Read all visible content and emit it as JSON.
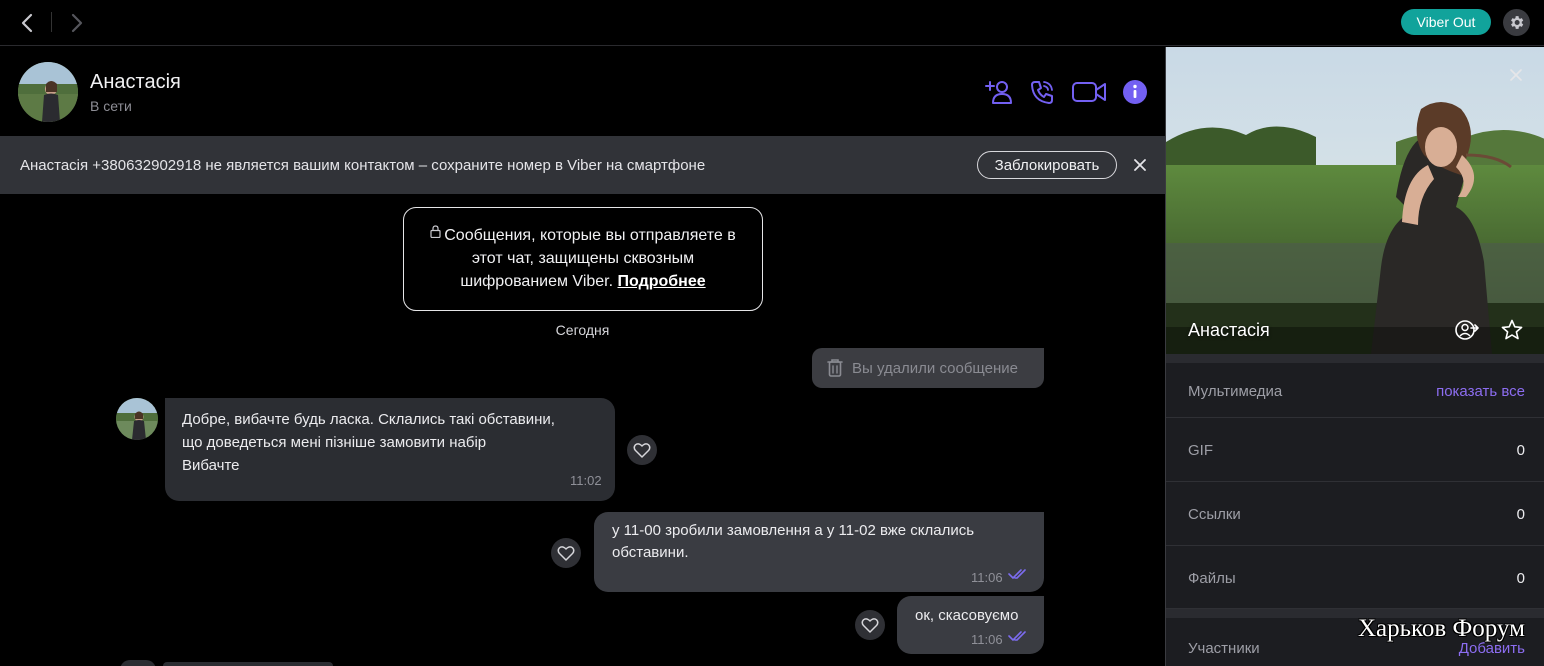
{
  "app": {
    "viber_out_label": "Viber Out"
  },
  "contact": {
    "name": "Анастасія",
    "status": "В сети"
  },
  "banner": {
    "text": "Анастасія +380632902918 не является вашим контактом – сохраните номер в Viber на смартфоне",
    "block_label": "Заблокировать"
  },
  "encryption_notice": {
    "text": "Сообщения, которые вы отправляете в этот чат, защищены сквозным шифрованием Viber.",
    "link_label": "Подробнее"
  },
  "date_separator": "Сегодня",
  "messages": [
    {
      "direction": "out",
      "deleted": true,
      "text": "Вы удалили сообщение"
    },
    {
      "direction": "in",
      "lines": [
        "Добре, вибачте будь ласка. Склались такі обставини,",
        "що доведеться мені пізніше замовити набір",
        "Вибачте"
      ],
      "time": "11:02"
    },
    {
      "direction": "out",
      "lines": [
        "у  11-00 зробили замовлення а у 11-02 вже склались",
        "обставини."
      ],
      "time": "11:06",
      "read": true
    },
    {
      "direction": "out",
      "lines": [
        "ок, скасовуємо"
      ],
      "time": "11:06",
      "read": true
    }
  ],
  "profile": {
    "name": "Анастасія",
    "media_label": "Мультимедиа",
    "media_link": "показать все",
    "rows": [
      {
        "label": "GIF",
        "value": "0"
      },
      {
        "label": "Ссылки",
        "value": "0"
      },
      {
        "label": "Файлы",
        "value": "0"
      }
    ],
    "participants_label": "Участники",
    "participants_action": "Добавить"
  },
  "watermark": "Харьков Форум",
  "colors": {
    "accent": "#7360f2",
    "viber_out": "#11a39b",
    "incoming_bubble": "#2b2d32",
    "outgoing_bubble": "#3a3c42",
    "banner": "#313338"
  },
  "icons": {
    "back": "chevron-left-icon",
    "forward": "chevron-right-icon",
    "settings": "gear-icon",
    "add_contact": "add-user-icon",
    "call": "phone-icon",
    "video": "video-camera-icon",
    "info": "info-icon",
    "close": "close-icon",
    "lock": "lock-icon",
    "trash": "trash-icon",
    "heart": "heart-icon",
    "read": "double-check-icon",
    "share": "share-contact-icon",
    "star": "star-icon"
  }
}
